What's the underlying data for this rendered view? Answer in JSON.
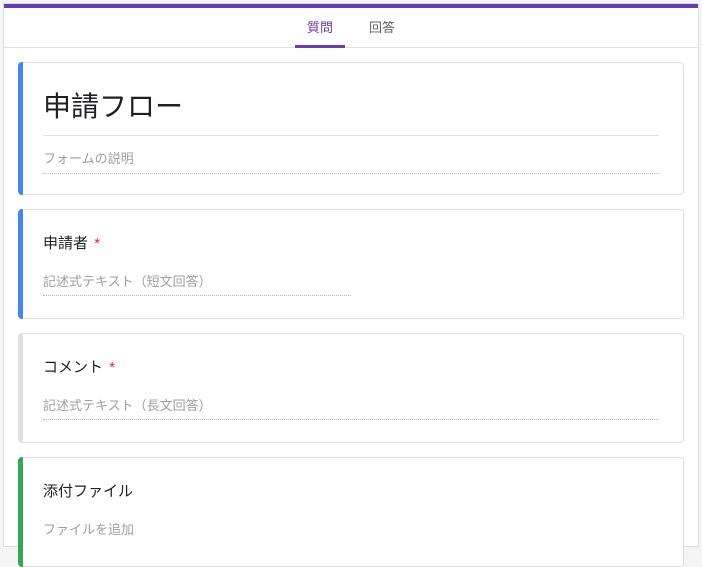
{
  "tabs": {
    "questions": "質問",
    "responses": "回答"
  },
  "header": {
    "title": "申請フロー",
    "description_placeholder": "フォームの説明"
  },
  "questions": [
    {
      "title": "申請者",
      "required": true,
      "answer_placeholder": "記述式テキスト（短文回答）"
    },
    {
      "title": "コメント",
      "required": true,
      "answer_placeholder": "記述式テキスト（長文回答）"
    },
    {
      "title": "添付ファイル",
      "required": false,
      "file_add_label": "ファイルを追加"
    }
  ],
  "required_mark": "*"
}
